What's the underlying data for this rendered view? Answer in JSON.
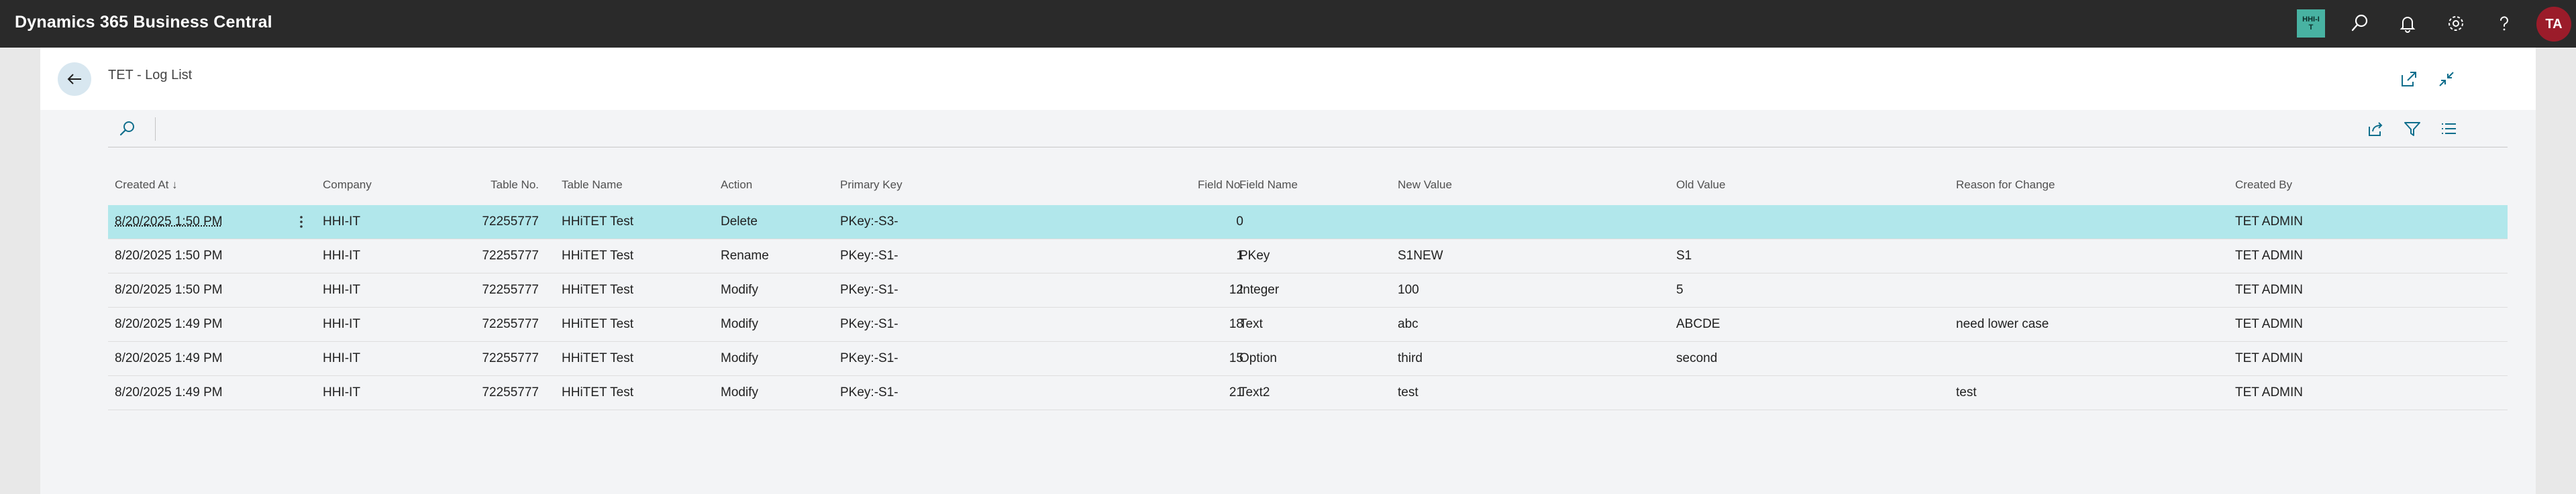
{
  "app": {
    "title": "Dynamics 365 Business Central",
    "company_badge": "HHI-IT",
    "avatar_initials": "TA"
  },
  "icons": {
    "top": [
      "search-icon",
      "bell-icon",
      "gear-icon",
      "help-icon"
    ],
    "header": [
      "open-new-window-icon",
      "collapse-icon"
    ],
    "action_bar": [
      "search-icon",
      "share-icon",
      "filter-icon",
      "list-view-icon"
    ]
  },
  "page": {
    "title": "TET - Log List"
  },
  "table": {
    "columns": [
      {
        "key": "created_at",
        "label": "Created At ↓"
      },
      {
        "key": "company",
        "label": "Company"
      },
      {
        "key": "table_no",
        "label": "Table No."
      },
      {
        "key": "table_name",
        "label": "Table Name"
      },
      {
        "key": "action",
        "label": "Action"
      },
      {
        "key": "primary_key",
        "label": "Primary Key"
      },
      {
        "key": "field_no",
        "label": "Field No."
      },
      {
        "key": "field_name",
        "label": "Field Name"
      },
      {
        "key": "new_value",
        "label": "New Value"
      },
      {
        "key": "old_value",
        "label": "Old Value"
      },
      {
        "key": "reason",
        "label": "Reason for Change"
      },
      {
        "key": "created_by",
        "label": "Created By"
      }
    ],
    "rows": [
      {
        "created_at": "8/20/2025 1:50 PM",
        "company": "HHI-IT",
        "table_no": "72255777",
        "table_name": "HHiTET Test",
        "action": "Delete",
        "primary_key": "PKey:-S3-",
        "field_no": "0",
        "field_name": "",
        "new_value": "",
        "old_value": "",
        "reason": "",
        "created_by": "TET ADMIN"
      },
      {
        "created_at": "8/20/2025 1:50 PM",
        "company": "HHI-IT",
        "table_no": "72255777",
        "table_name": "HHiTET Test",
        "action": "Rename",
        "primary_key": "PKey:-S1-",
        "field_no": "1",
        "field_name": "PKey",
        "new_value": "S1NEW",
        "old_value": "S1",
        "reason": "",
        "created_by": "TET ADMIN"
      },
      {
        "created_at": "8/20/2025 1:50 PM",
        "company": "HHI-IT",
        "table_no": "72255777",
        "table_name": "HHiTET Test",
        "action": "Modify",
        "primary_key": "PKey:-S1-",
        "field_no": "12",
        "field_name": "Integer",
        "new_value": "100",
        "old_value": "5",
        "reason": "",
        "created_by": "TET ADMIN"
      },
      {
        "created_at": "8/20/2025 1:49 PM",
        "company": "HHI-IT",
        "table_no": "72255777",
        "table_name": "HHiTET Test",
        "action": "Modify",
        "primary_key": "PKey:-S1-",
        "field_no": "18",
        "field_name": "Text",
        "new_value": "abc",
        "old_value": "ABCDE",
        "reason": "need lower case",
        "created_by": "TET ADMIN"
      },
      {
        "created_at": "8/20/2025 1:49 PM",
        "company": "HHI-IT",
        "table_no": "72255777",
        "table_name": "HHiTET Test",
        "action": "Modify",
        "primary_key": "PKey:-S1-",
        "field_no": "15",
        "field_name": "Option",
        "new_value": "third",
        "old_value": "second",
        "reason": "",
        "created_by": "TET ADMIN"
      },
      {
        "created_at": "8/20/2025 1:49 PM",
        "company": "HHI-IT",
        "table_no": "72255777",
        "table_name": "HHiTET Test",
        "action": "Modify",
        "primary_key": "PKey:-S1-",
        "field_no": "21",
        "field_name": "Text2",
        "new_value": "test",
        "old_value": "",
        "reason": "test",
        "created_by": "TET ADMIN"
      }
    ],
    "selected_row": 0
  },
  "colors": {
    "topbar": "#2a2a2a",
    "badge": "#48b2a2",
    "avatar": "#9b1c2a",
    "selected_row": "#b1e7eb",
    "accent": "#0f6e8c"
  }
}
